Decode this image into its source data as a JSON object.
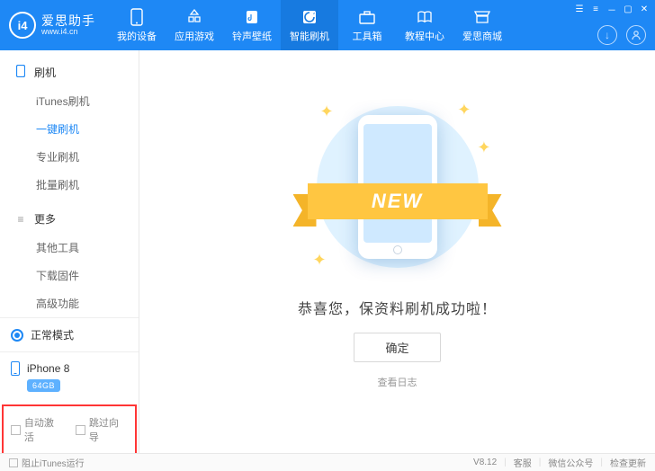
{
  "app": {
    "name": "爱思助手",
    "site": "www.i4.cn",
    "logo_text": "i4"
  },
  "nav": {
    "items": [
      {
        "label": "我的设备",
        "icon": "phone"
      },
      {
        "label": "应用游戏",
        "icon": "apps"
      },
      {
        "label": "铃声壁纸",
        "icon": "music"
      },
      {
        "label": "智能刷机",
        "icon": "flash",
        "active": true
      },
      {
        "label": "工具箱",
        "icon": "tools"
      },
      {
        "label": "教程中心",
        "icon": "book"
      },
      {
        "label": "爱思商城",
        "icon": "store"
      }
    ]
  },
  "sidebar": {
    "groups": [
      {
        "title": "刷机",
        "icon": "phone",
        "items": [
          {
            "label": "iTunes刷机"
          },
          {
            "label": "一键刷机",
            "active": true
          },
          {
            "label": "专业刷机"
          },
          {
            "label": "批量刷机"
          }
        ]
      },
      {
        "title": "更多",
        "icon": "more",
        "items": [
          {
            "label": "其他工具"
          },
          {
            "label": "下载固件"
          },
          {
            "label": "高级功能"
          }
        ]
      }
    ],
    "mode": "正常模式",
    "device_name": "iPhone 8",
    "device_capacity": "64GB",
    "checkboxes": [
      {
        "label": "自动激活"
      },
      {
        "label": "跳过向导"
      }
    ]
  },
  "main": {
    "ribbon": "NEW",
    "success_text": "恭喜您，保资料刷机成功啦！",
    "confirm_label": "确定",
    "view_log_label": "查看日志"
  },
  "footer": {
    "block_itunes": "阻止iTunes运行",
    "version": "V8.12",
    "links": [
      "客服",
      "微信公众号",
      "检查更新"
    ]
  },
  "colors": {
    "primary": "#1e88f5",
    "ribbon": "#ffc641"
  }
}
